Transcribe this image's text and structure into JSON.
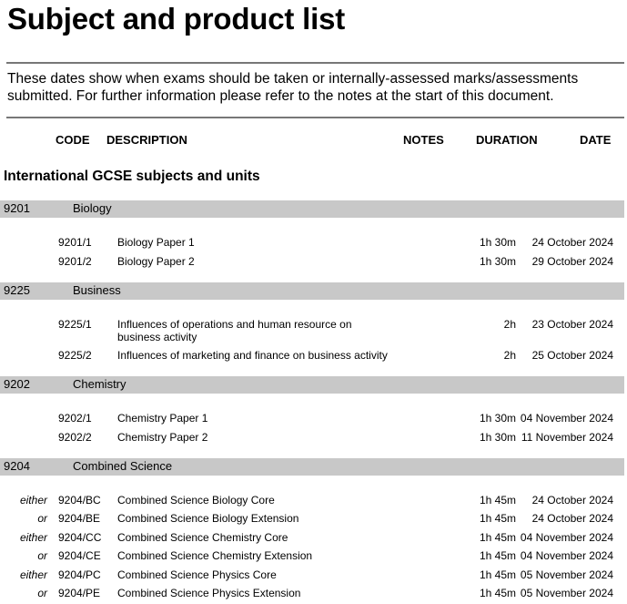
{
  "title": "Subject and product list",
  "intro": {
    "line1": "These dates show when exams should be taken or internally-assessed marks/assessments",
    "line2": "submitted.  For further information please refer to the notes at the start of this document."
  },
  "headers": {
    "code": "CODE",
    "description": "DESCRIPTION",
    "notes": "NOTES",
    "duration": "DURATION",
    "date": "DATE"
  },
  "section_title": "International GCSE subjects and units",
  "subjects": [
    {
      "code": "9201",
      "name": "Biology",
      "units": [
        {
          "prefix": "",
          "code": "9201/1",
          "desc": "Biology Paper 1",
          "duration": "1h 30m",
          "date": "24 October 2024"
        },
        {
          "prefix": "",
          "code": "9201/2",
          "desc": "Biology Paper 2",
          "duration": "1h 30m",
          "date": "29 October 2024"
        }
      ]
    },
    {
      "code": "9225",
      "name": "Business",
      "units": [
        {
          "prefix": "",
          "code": "9225/1",
          "desc": "Influences of operations and human resource on business activity",
          "duration": "2h",
          "date": "23 October 2024"
        },
        {
          "prefix": "",
          "code": "9225/2",
          "desc": "Influences of marketing and finance on business activity",
          "duration": "2h",
          "date": "25 October 2024"
        }
      ]
    },
    {
      "code": "9202",
      "name": "Chemistry",
      "units": [
        {
          "prefix": "",
          "code": "9202/1",
          "desc": "Chemistry Paper 1",
          "duration": "1h 30m",
          "date": "04 November 2024"
        },
        {
          "prefix": "",
          "code": "9202/2",
          "desc": "Chemistry Paper 2",
          "duration": "1h 30m",
          "date": "11 November 2024"
        }
      ]
    },
    {
      "code": "9204",
      "name": "Combined Science",
      "units": [
        {
          "prefix": "either",
          "code": "9204/BC",
          "desc": "Combined Science Biology Core",
          "duration": "1h 45m",
          "date": "24 October 2024"
        },
        {
          "prefix": "or",
          "code": "9204/BE",
          "desc": "Combined Science Biology Extension",
          "duration": "1h 45m",
          "date": "24 October 2024"
        },
        {
          "prefix": "either",
          "code": "9204/CC",
          "desc": "Combined Science Chemistry Core",
          "duration": "1h 45m",
          "date": "04 November 2024"
        },
        {
          "prefix": "or",
          "code": "9204/CE",
          "desc": "Combined Science Chemistry Extension",
          "duration": "1h 45m",
          "date": "04 November 2024"
        },
        {
          "prefix": "either",
          "code": "9204/PC",
          "desc": "Combined Science Physics Core",
          "duration": "1h 45m",
          "date": "05 November 2024"
        },
        {
          "prefix": "or",
          "code": "9204/PE",
          "desc": "Combined Science Physics Extension",
          "duration": "1h 45m",
          "date": "05 November 2024"
        }
      ]
    }
  ]
}
